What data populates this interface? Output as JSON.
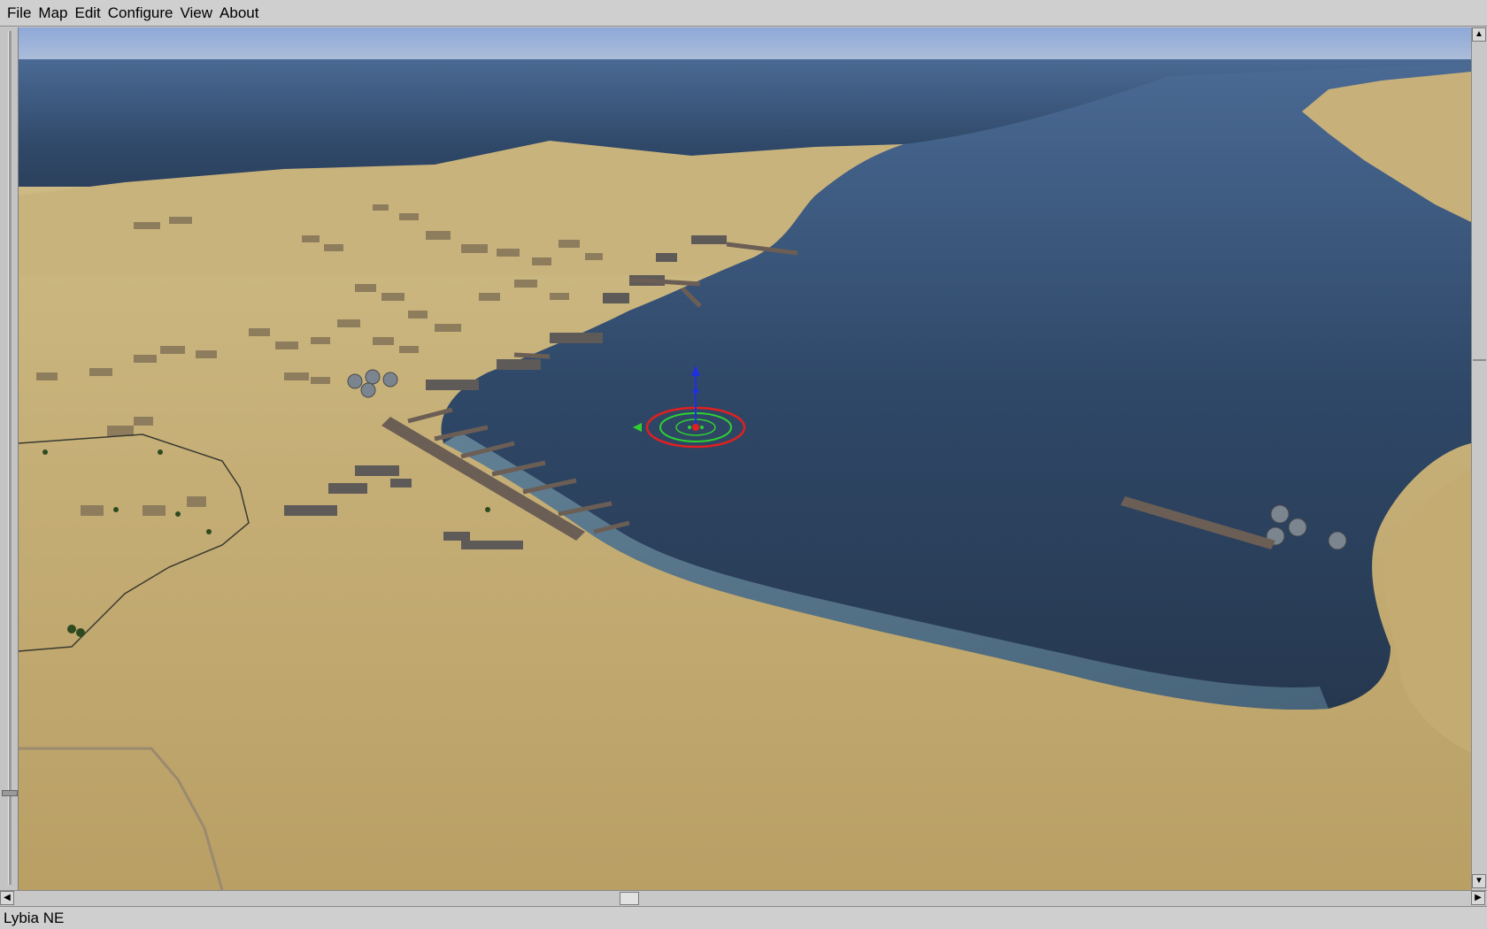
{
  "menubar": {
    "items": [
      "File",
      "Map",
      "Edit",
      "Configure",
      "View",
      "About"
    ]
  },
  "status": {
    "map_name": "Lybia NE"
  },
  "scrollbars": {
    "up_arrow": "▲",
    "down_arrow": "▼",
    "left_arrow": "◀",
    "right_arrow": "▶"
  },
  "colors": {
    "sky": "#8fa9d6",
    "sea_deep": "#2a3d58",
    "sand": "#c2aa72",
    "gizmo_red": "#e02020",
    "gizmo_green": "#30d030",
    "gizmo_blue": "#2030e0"
  },
  "icons": [
    "selection-gizmo-icon"
  ]
}
